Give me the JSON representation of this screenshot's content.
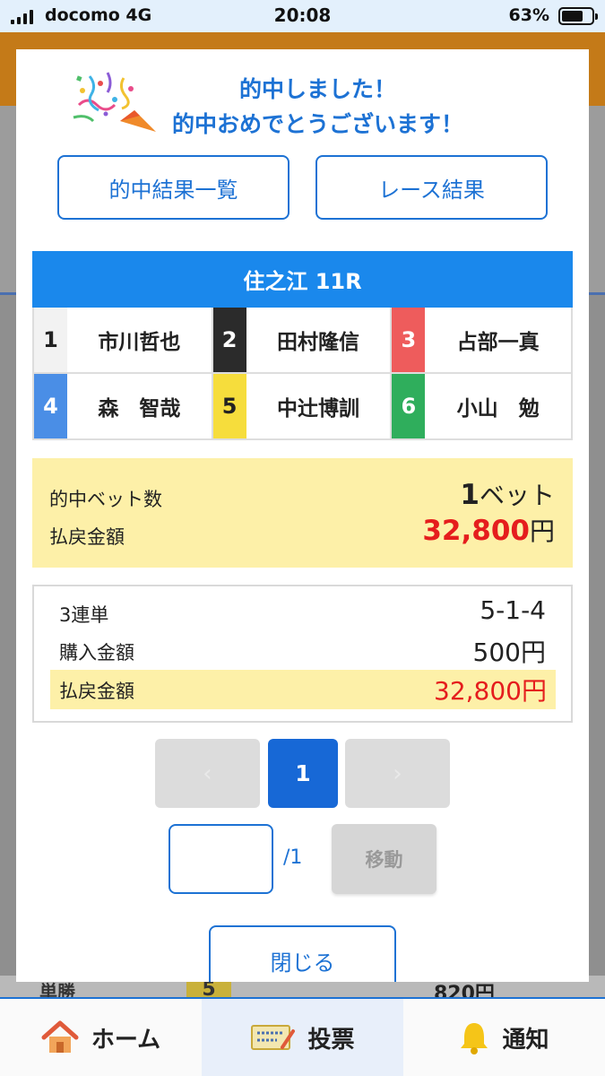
{
  "status_bar": {
    "carrier": "docomo  4G",
    "time": "20:08",
    "battery": "63%",
    "battery_level": 0.63
  },
  "background": {
    "row_label": "単勝",
    "row_number": "5",
    "row_payout": "820円"
  },
  "modal": {
    "congrats_line1": "的中しました！",
    "congrats_line2": "的中おめでとうございます！",
    "hits_list_button": "的中結果一覧",
    "race_result_button": "レース結果",
    "race_title": "住之江 11R",
    "racers": [
      {
        "number": "1",
        "name": "市川哲也",
        "color": "#f2f2f2",
        "text_color": "#222222"
      },
      {
        "number": "2",
        "name": "田村隆信",
        "color": "#2b2b2b",
        "text_color": "#ffffff"
      },
      {
        "number": "3",
        "name": "占部一真",
        "color": "#ee5c5c",
        "text_color": "#ffffff"
      },
      {
        "number": "4",
        "name": "森　智哉",
        "color": "#4a8ee6",
        "text_color": "#ffffff"
      },
      {
        "number": "5",
        "name": "中辻博訓",
        "color": "#f6dd3c",
        "text_color": "#222222"
      },
      {
        "number": "6",
        "name": "小山　勉",
        "color": "#2fae5c",
        "text_color": "#ffffff"
      }
    ],
    "summary": {
      "bets_label": "的中ベット数",
      "bets_value": "1",
      "bets_unit": "ベット",
      "payout_label": "払戻金額",
      "payout_value": "32,800",
      "payout_unit": "円"
    },
    "detail": {
      "bet_type": "3連単",
      "combination": "5-1-4",
      "cost_label": "購入金額",
      "cost_value": "500円",
      "payout_label": "払戻金額",
      "payout_value": "32,800円"
    },
    "pager": {
      "prev": "‹",
      "current_page": "1",
      "next": "›",
      "input_value": "",
      "total": "/1",
      "move_button": "移動"
    },
    "close_button": "閉じる"
  },
  "tabbar": {
    "home": "ホーム",
    "vote": "投票",
    "notify": "通知"
  },
  "colors": {
    "accent": "#1d72d4",
    "race_header": "#1a88ec",
    "highlight": "#fdf0a8",
    "payout_red": "#e51d1d"
  },
  "icons": [
    "signal-icon",
    "battery-icon",
    "confetti-icon",
    "home-icon",
    "ticket-icon",
    "bell-icon"
  ]
}
